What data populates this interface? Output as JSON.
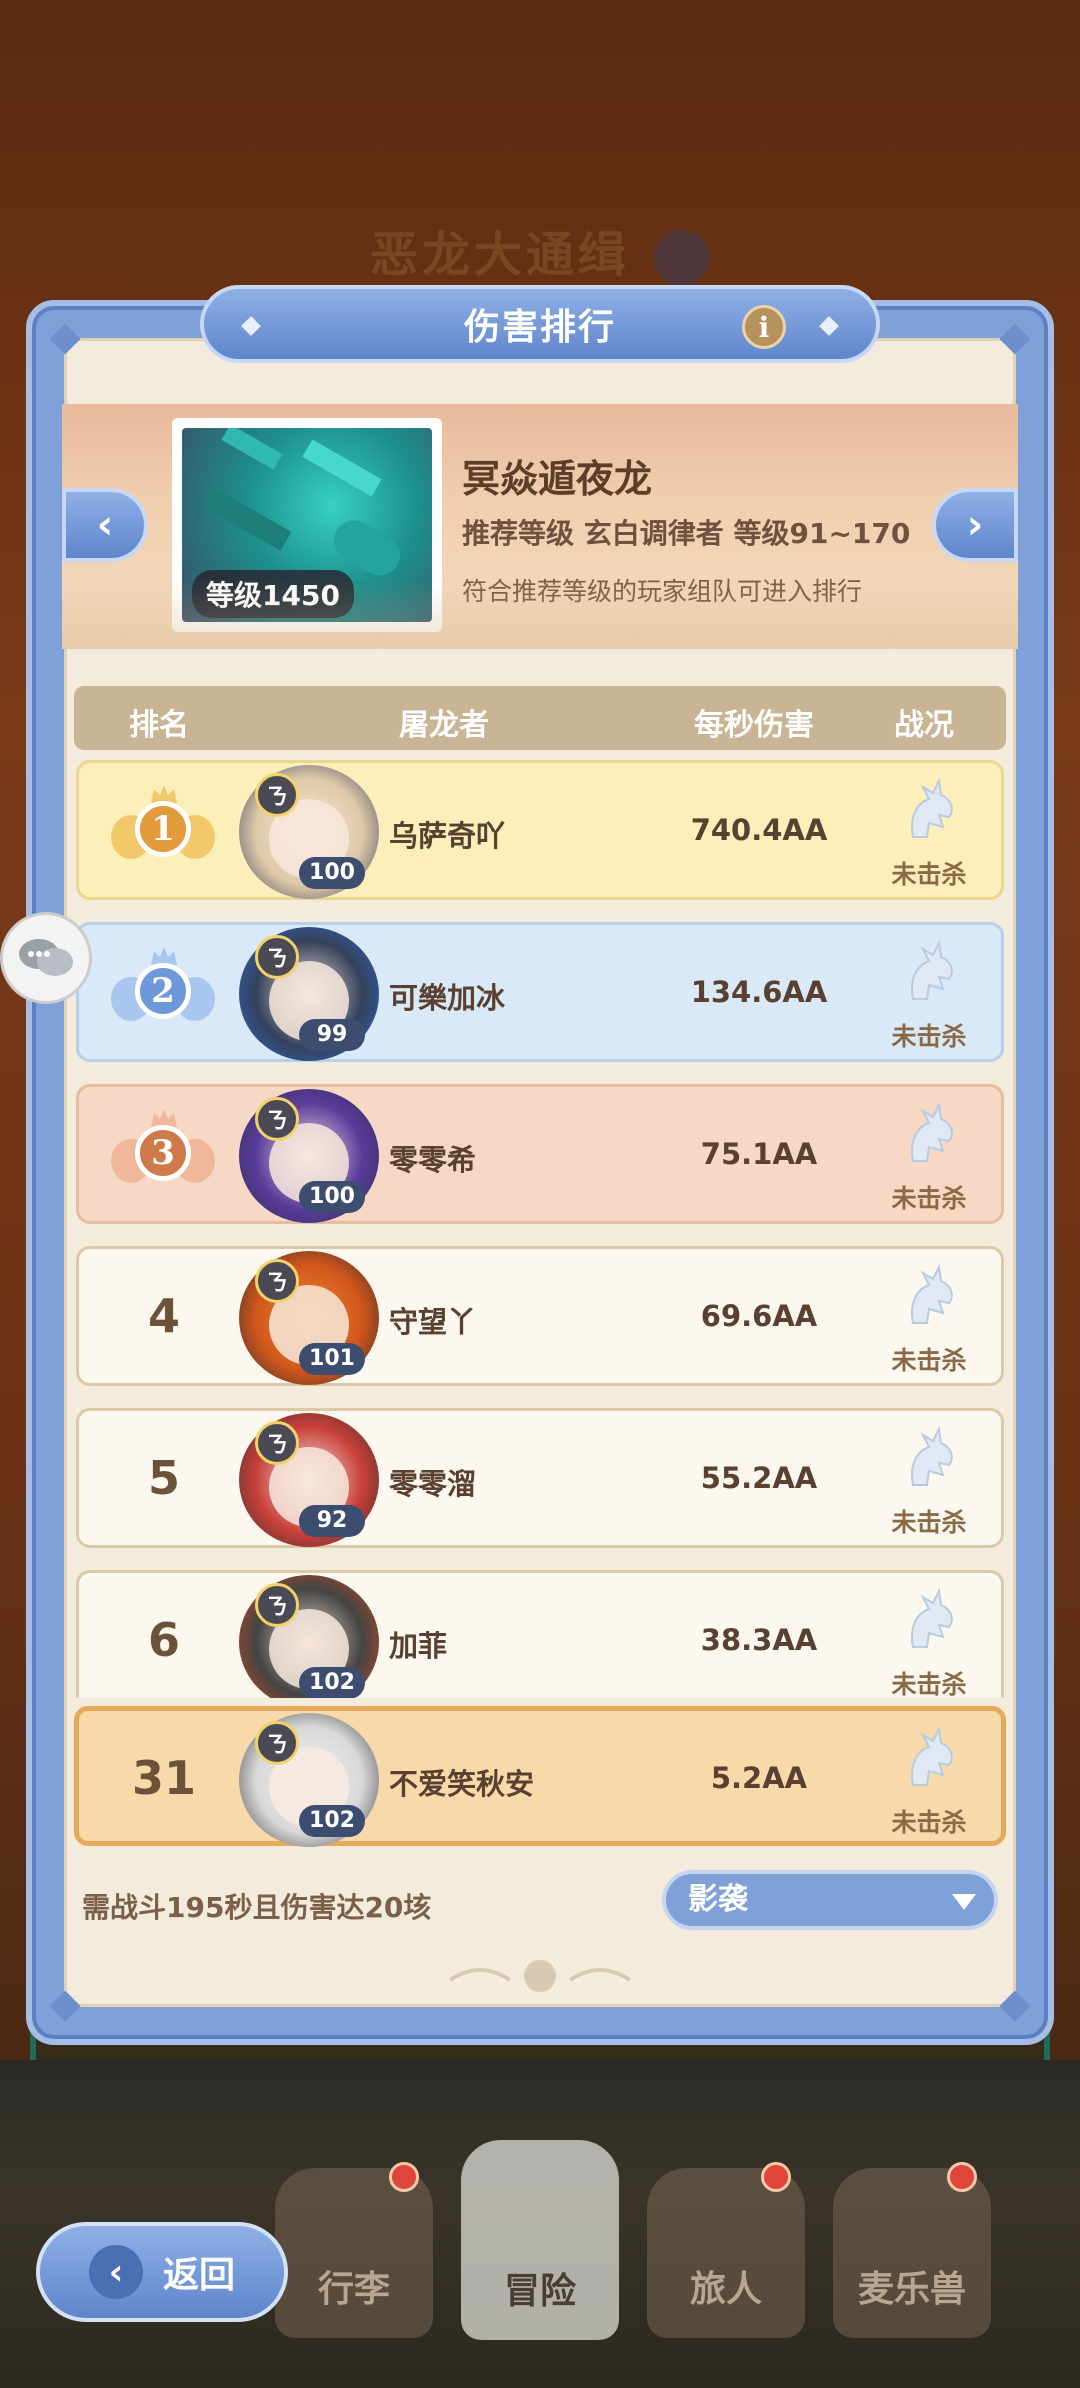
{
  "background": {
    "title": "恶龙大通缉"
  },
  "panel": {
    "title": "伤害排行",
    "info_icon": "info-icon"
  },
  "boss": {
    "level_badge": "等级1450",
    "name": "冥焱遁夜龙",
    "recommend": "推荐等级  玄白调律者  等级91~170",
    "note": "符合推荐等级的玩家组队可进入排行"
  },
  "table": {
    "headers": {
      "rank": "排名",
      "player": "屠龙者",
      "dps": "每秒伤害",
      "status": "战况"
    },
    "rows": [
      {
        "rank": "1",
        "name": "乌萨奇吖",
        "level": "100",
        "dps": "740.4AA",
        "status": "未击杀",
        "tier": "gold"
      },
      {
        "rank": "2",
        "name": "可樂加冰",
        "level": "99",
        "dps": "134.6AA",
        "status": "未击杀",
        "tier": "silver"
      },
      {
        "rank": "3",
        "name": "零零希",
        "level": "100",
        "dps": "75.1AA",
        "status": "未击杀",
        "tier": "bronze"
      },
      {
        "rank": "4",
        "name": "守望丫",
        "level": "101",
        "dps": "69.6AA",
        "status": "未击杀",
        "tier": "normal"
      },
      {
        "rank": "5",
        "name": "零零溜",
        "level": "92",
        "dps": "55.2AA",
        "status": "未击杀",
        "tier": "normal"
      },
      {
        "rank": "6",
        "name": "加菲",
        "level": "102",
        "dps": "38.3AA",
        "status": "未击杀",
        "tier": "normal"
      }
    ],
    "my_row": {
      "rank": "31",
      "name": "不爱笑秋安",
      "level": "102",
      "dps": "5.2AA",
      "status": "未击杀"
    }
  },
  "footer": {
    "requirement": "需战斗195秒且伤害达20垓",
    "dropdown_value": "影袭"
  },
  "bottom_nav": {
    "back_label": "返回",
    "items": [
      "行李",
      "冒险",
      "旅人",
      "麦乐兽"
    ]
  },
  "colors": {
    "panel_blue": "#7fa0d8",
    "gold_row": "#fcefb9",
    "silver_row": "#d9e9f7",
    "bronze_row": "#f7d8c5",
    "my_row": "#f8d9a9"
  }
}
